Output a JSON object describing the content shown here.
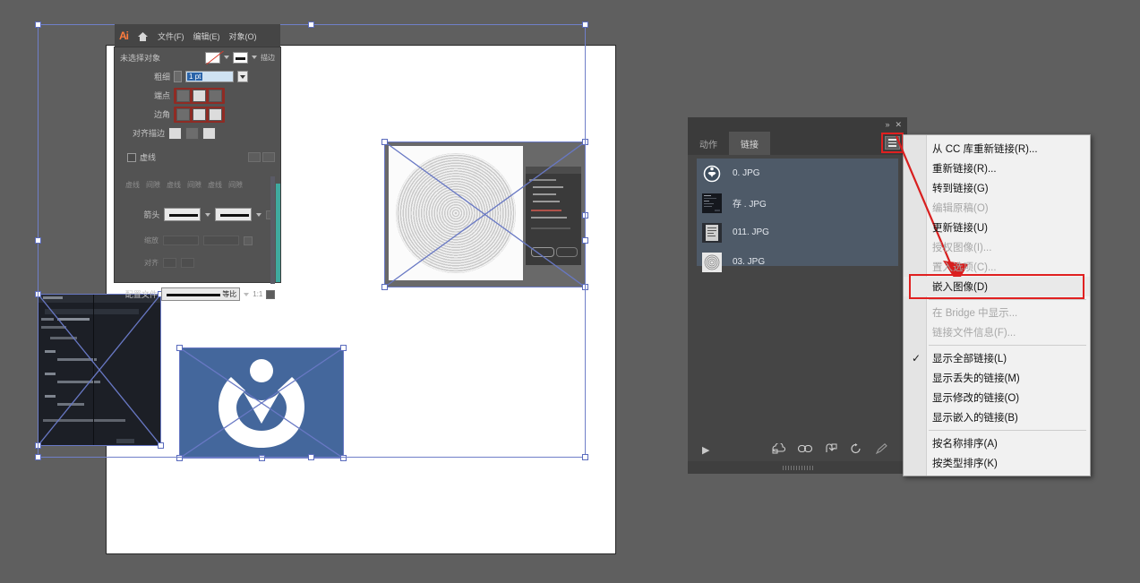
{
  "app": {
    "name": "Adobe Illustrator",
    "logo_text": "Ai",
    "background_color": "#5f5f5f",
    "artboard_color": "#ffffff"
  },
  "menubar": {
    "logo": "Ai",
    "home_icon": "home-icon",
    "items": [
      {
        "label": "文件(F)"
      },
      {
        "label": "编辑(E)"
      },
      {
        "label": "对象(O)"
      }
    ]
  },
  "properties_panel": {
    "title": "未选择对象",
    "fill_swatch": "none-swatch",
    "stroke_label": "描边",
    "rows": {
      "weight_label": "粗细",
      "weight_value": "1 pt",
      "cap_label": "端点",
      "corner_label": "边角",
      "align_label": "对齐描边",
      "dashed_label": "虚线",
      "dash_fields": [
        "虚线",
        "间隙",
        "虚线",
        "间隙",
        "虚线",
        "间隙"
      ],
      "arrows_label": "箭头",
      "scale_label": "缩放",
      "align_row_label": "对齐",
      "profile_label": "配置文件",
      "profile_value": "等比",
      "profile_ratio": "1:1"
    }
  },
  "links_panel": {
    "titlebar": {
      "collapse_icon": "collapse-icon",
      "collapse_glyph": "»",
      "close_icon": "close-icon",
      "close_glyph": "✕"
    },
    "tabs": [
      {
        "label": "动作",
        "active": false
      },
      {
        "label": "链接",
        "active": true
      }
    ],
    "menu_button": "panel-menu-icon",
    "items": [
      {
        "name": "0. JPG",
        "thumb": "circle-logo-thumb"
      },
      {
        "name": "存 . JPG",
        "thumb": "dark-screenshot-thumb"
      },
      {
        "name": "011. JPG",
        "thumb": "document-thumb"
      },
      {
        "name": "03. JPG",
        "thumb": "pattern-thumb"
      }
    ],
    "footer_icons": [
      "play-icon",
      "cc-library-icon",
      "relink-icon",
      "goto-link-icon",
      "update-link-icon",
      "edit-original-icon"
    ]
  },
  "flyout_menu": {
    "highlight_color": "#e02020",
    "highlighted_item": "嵌入图像(D)",
    "groups": [
      {
        "items": [
          {
            "label": "从 CC 库重新链接(R)...",
            "disabled": false,
            "checked": false
          },
          {
            "label": "重新链接(R)...",
            "disabled": false,
            "checked": false
          },
          {
            "label": "转到链接(G)",
            "disabled": false,
            "checked": false
          },
          {
            "label": "编辑原稿(O)",
            "disabled": true,
            "checked": false
          },
          {
            "label": "更新链接(U)",
            "disabled": false,
            "checked": false
          },
          {
            "label": "授权图像(I)...",
            "disabled": true,
            "checked": false
          },
          {
            "label": "置入选项(C)...",
            "disabled": true,
            "checked": false
          },
          {
            "label": "嵌入图像(D)",
            "disabled": false,
            "checked": false,
            "highlighted": true
          }
        ]
      },
      {
        "items": [
          {
            "label": "在 Bridge 中显示...",
            "disabled": true,
            "checked": false
          },
          {
            "label": "链接文件信息(F)...",
            "disabled": true,
            "checked": false
          }
        ]
      },
      {
        "items": [
          {
            "label": "显示全部链接(L)",
            "disabled": false,
            "checked": true
          },
          {
            "label": "显示丢失的链接(M)",
            "disabled": false,
            "checked": false
          },
          {
            "label": "显示修改的链接(O)",
            "disabled": false,
            "checked": false
          },
          {
            "label": "显示嵌入的链接(B)",
            "disabled": false,
            "checked": false
          }
        ]
      },
      {
        "items": [
          {
            "label": "按名称排序(A)",
            "disabled": false,
            "checked": false
          },
          {
            "label": "按类型排序(K)",
            "disabled": false,
            "checked": false
          }
        ]
      }
    ]
  },
  "canvas_objects": [
    {
      "name": "dark-dialog-image",
      "type": "placed-image"
    },
    {
      "name": "moire-circle-image",
      "type": "placed-image"
    },
    {
      "name": "blue-logo-image",
      "type": "placed-image"
    }
  ]
}
